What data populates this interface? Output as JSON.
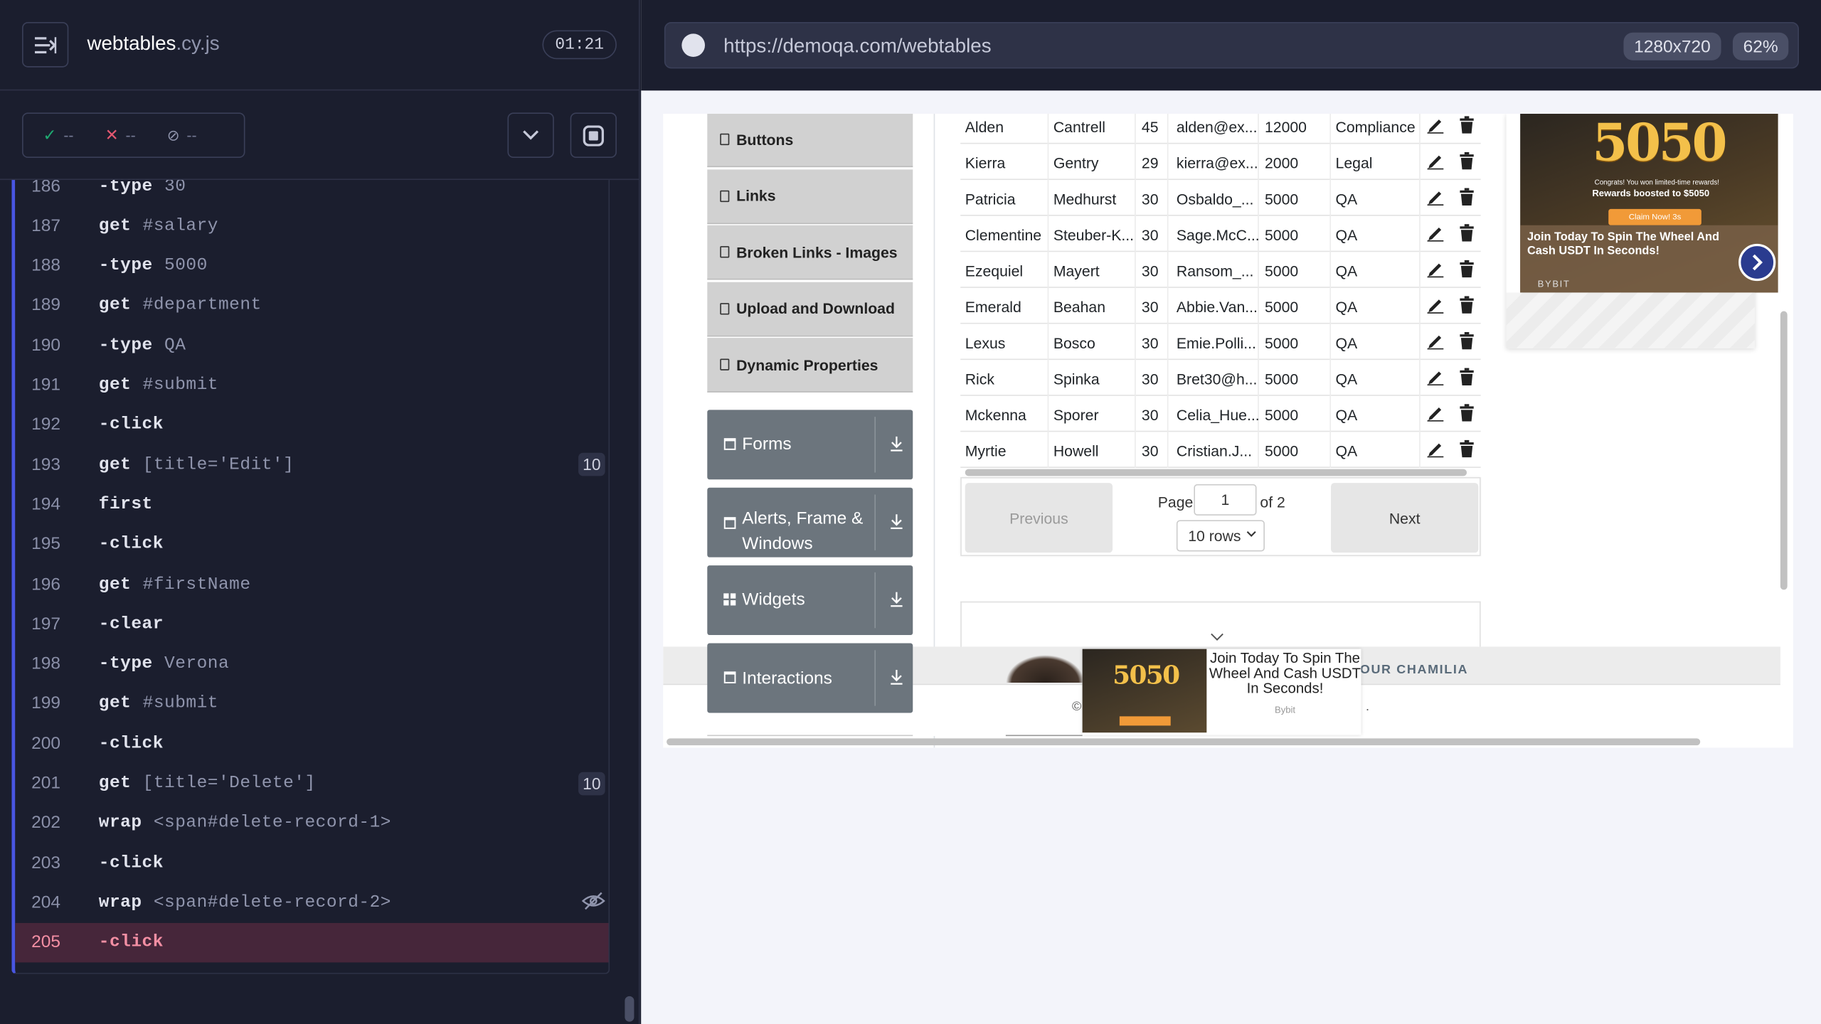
{
  "reporter": {
    "spec_name": "webtables",
    "spec_ext": ".cy.js",
    "timer": "01:21",
    "stats": {
      "passed": "--",
      "failed": "--",
      "pending": "--"
    },
    "commands": [
      {
        "num": "186",
        "name": "-type",
        "arg": "30",
        "badge": ""
      },
      {
        "num": "187",
        "name": "get",
        "arg": "#salary",
        "badge": ""
      },
      {
        "num": "188",
        "name": "-type",
        "arg": "5000",
        "badge": ""
      },
      {
        "num": "189",
        "name": "get",
        "arg": "#department",
        "badge": ""
      },
      {
        "num": "190",
        "name": "-type",
        "arg": "QA",
        "badge": ""
      },
      {
        "num": "191",
        "name": "get",
        "arg": "#submit",
        "badge": ""
      },
      {
        "num": "192",
        "name": "-click",
        "arg": "",
        "badge": ""
      },
      {
        "num": "193",
        "name": "get",
        "arg": "[title='Edit']",
        "badge": "10"
      },
      {
        "num": "194",
        "name": "first",
        "arg": "",
        "badge": ""
      },
      {
        "num": "195",
        "name": "-click",
        "arg": "",
        "badge": ""
      },
      {
        "num": "196",
        "name": "get",
        "arg": "#firstName",
        "badge": ""
      },
      {
        "num": "197",
        "name": "-clear",
        "arg": "",
        "badge": ""
      },
      {
        "num": "198",
        "name": "-type",
        "arg": "Verona",
        "badge": ""
      },
      {
        "num": "199",
        "name": "get",
        "arg": "#submit",
        "badge": ""
      },
      {
        "num": "200",
        "name": "-click",
        "arg": "",
        "badge": ""
      },
      {
        "num": "201",
        "name": "get",
        "arg": "[title='Delete']",
        "badge": "10"
      },
      {
        "num": "202",
        "name": "wrap",
        "arg": "<span#delete-record-1>",
        "badge": ""
      },
      {
        "num": "203",
        "name": "-click",
        "arg": "",
        "badge": ""
      },
      {
        "num": "204",
        "name": "wrap",
        "arg": "<span#delete-record-2>",
        "badge": ""
      },
      {
        "num": "205",
        "name": "-click",
        "arg": "",
        "badge": ""
      }
    ]
  },
  "aut": {
    "url": "https://demoqa.com/webtables",
    "viewport": "1280x720",
    "zoom": "62%",
    "sidebar_items": [
      "Buttons",
      "Links",
      "Broken Links - Images",
      "Upload and Download",
      "Dynamic Properties"
    ],
    "groups": [
      "Forms",
      "Alerts, Frame & Windows",
      "Widgets",
      "Interactions"
    ],
    "table_rows": [
      [
        "Alden",
        "Cantrell",
        "45",
        "alden@ex...",
        "12000",
        "Compliance"
      ],
      [
        "Kierra",
        "Gentry",
        "29",
        "kierra@ex...",
        "2000",
        "Legal"
      ],
      [
        "Patricia",
        "Medhurst",
        "30",
        "Osbaldo_...",
        "5000",
        "QA"
      ],
      [
        "Clementine",
        "Steuber-K...",
        "30",
        "Sage.McC...",
        "5000",
        "QA"
      ],
      [
        "Ezequiel",
        "Mayert",
        "30",
        "Ransom_...",
        "5000",
        "QA"
      ],
      [
        "Emerald",
        "Beahan",
        "30",
        "Abbie.Van...",
        "5000",
        "QA"
      ],
      [
        "Lexus",
        "Bosco",
        "30",
        "Emie.Polli...",
        "5000",
        "QA"
      ],
      [
        "Rick",
        "Spinka",
        "30",
        "Bret30@h...",
        "5000",
        "QA"
      ],
      [
        "Mckenna",
        "Sporer",
        "30",
        "Celia_Hue...",
        "5000",
        "QA"
      ],
      [
        "Myrtie",
        "Howell",
        "30",
        "Cristian.J...",
        "5000",
        "QA"
      ]
    ],
    "pagination": {
      "previous": "Previous",
      "next": "Next",
      "page_label": "Page",
      "page_value": "1",
      "of_label": "of 2",
      "rows_label": "10 rows"
    },
    "ad": {
      "big": "5050",
      "line1": "Congrats! You won limited-time rewards!",
      "line2": "Rewards boosted to $5050",
      "claim": "Claim Now! 3s",
      "title": "Join Today To Spin The Wheel And Cash USDT In Seconds!",
      "brand": "BYBIT"
    },
    "overlay_ad": {
      "big": "5050",
      "text": "Join Today To Spin The Wheel And Cash USDT In Seconds!",
      "brand": "Bybit"
    },
    "footer_text": "OUR CHAMILIA",
    "copyright_left": "©",
    "copyright_right": "."
  }
}
